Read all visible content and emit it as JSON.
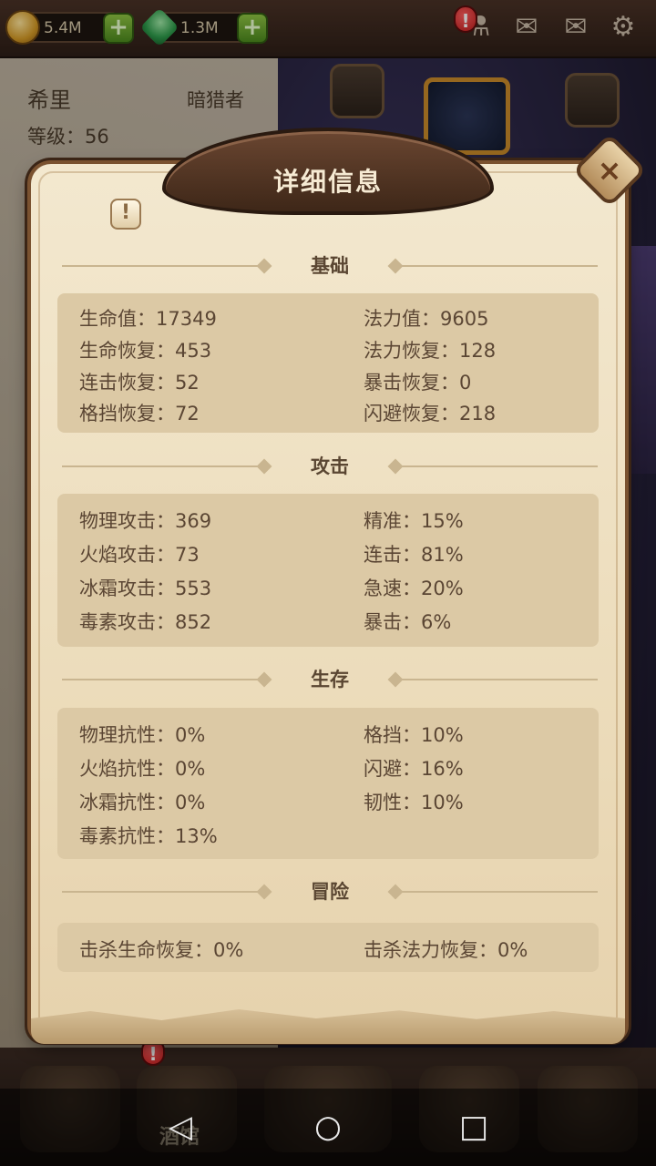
{
  "topbar": {
    "gold": "5.4M",
    "gems": "1.3M",
    "alert": "!"
  },
  "background": {
    "hero_name": "希里",
    "hero_class": "暗猎者",
    "hero_level": "等级：56"
  },
  "modal": {
    "title": "详细信息",
    "close": "×",
    "info": "!"
  },
  "sections": {
    "basic": {
      "title": "基础",
      "stats": [
        "生命值：17349",
        "法力值：9605",
        "生命恢复：453",
        "法力恢复：128",
        "连击恢复：52",
        "暴击恢复：0",
        "格挡恢复：72",
        "闪避恢复：218"
      ]
    },
    "attack": {
      "title": "攻击",
      "stats": [
        "物理攻击：369",
        "精准：15%",
        "火焰攻击：73",
        "连击：81%",
        "冰霜攻击：553",
        "急速：20%",
        "毒素攻击：852",
        "暴击：6%"
      ]
    },
    "survival": {
      "title": "生存",
      "stats": [
        "物理抗性：0%",
        "格挡：10%",
        "火焰抗性：0%",
        "闪避：16%",
        "冰霜抗性：0%",
        "韧性：10%",
        "毒素抗性：13%"
      ]
    },
    "adventure": {
      "title": "冒险",
      "stats": [
        "击杀生命恢复：0%",
        "击杀法力恢复：0%"
      ]
    }
  },
  "bottom_menu": {
    "tavern_label": "酒馆",
    "alert": "!"
  },
  "android_nav": {
    "back": "◁",
    "home": "○",
    "recent": "□"
  }
}
